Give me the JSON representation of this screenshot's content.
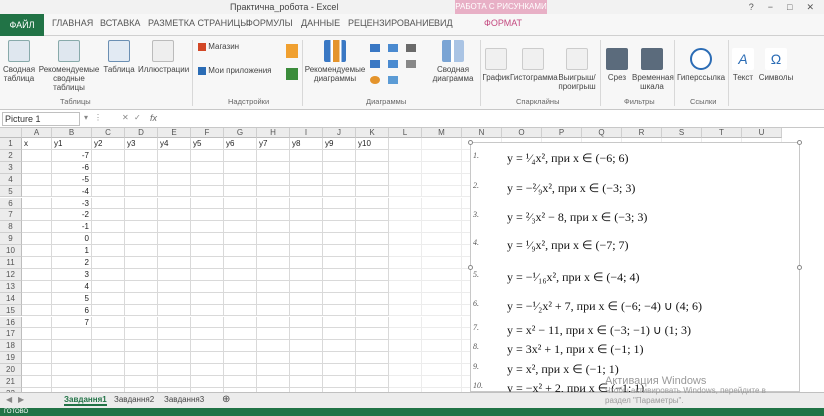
{
  "window": {
    "title": "Практична_робота - Excel",
    "context_tab": "РАБОТА С РИСУНКАМИ",
    "controls": [
      "?",
      "−",
      "□",
      "✕"
    ]
  },
  "tabs": [
    "ФАЙЛ",
    "ГЛАВНАЯ",
    "ВСТАВКА",
    "РАЗМЕТКА СТРАНИЦЫ",
    "ФОРМУЛЫ",
    "ДАННЫЕ",
    "РЕЦЕНЗИРОВАНИЕ",
    "ВИД",
    "ФОРМАТ"
  ],
  "ribbon": {
    "buttons": [
      "Сводная таблица",
      "Рекомендуемые сводные таблицы",
      "Таблица",
      "Иллюстрации",
      "Магазин",
      "Мои приложения",
      "Рекомендуемые диаграммы",
      "Сводная диаграмма",
      "График",
      "Гистограмма",
      "Выигрыш/ проигрыш",
      "Срез",
      "Временная шкала",
      "Гиперссылка",
      "Текст",
      "Символы"
    ],
    "groups": [
      "Таблицы",
      "Надстройки",
      "Диаграммы",
      "Спарклайны",
      "Фильтры",
      "Ссылки"
    ]
  },
  "formula_bar": {
    "name_box": "Picture 1",
    "fx_label": "fx",
    "icons": [
      "▾",
      "⋮",
      "✕",
      "✓"
    ]
  },
  "columns": [
    "A",
    "B",
    "C",
    "D",
    "E",
    "F",
    "G",
    "H",
    "I",
    "J",
    "K",
    "L",
    "M",
    "N",
    "O",
    "P",
    "Q",
    "R",
    "S",
    "T",
    "U"
  ],
  "rows": [
    "1",
    "2",
    "3",
    "4",
    "5",
    "6",
    "7",
    "8",
    "9",
    "10",
    "11",
    "12",
    "13",
    "14",
    "15",
    "16",
    "17",
    "18",
    "19",
    "20",
    "21",
    "22"
  ],
  "sheet": {
    "header_row": [
      "x",
      "y1",
      "y2",
      "y3",
      "y4",
      "y5",
      "y6",
      "y7",
      "y8",
      "y9",
      "y10"
    ],
    "x_values": [
      "-7",
      "-6",
      "-5",
      "-4",
      "-3",
      "-2",
      "-1",
      "0",
      "1",
      "2",
      "3",
      "4",
      "5",
      "6",
      "7"
    ]
  },
  "equations": [
    {
      "n": "1.",
      "text": "y = ¹⁄₄x², при x ∈ (−6; 6)"
    },
    {
      "n": "2.",
      "text": "y = −²⁄₉x², при x ∈ (−3; 3)"
    },
    {
      "n": "3.",
      "text": "y = ²⁄₃x² − 8, при x ∈ (−3; 3)"
    },
    {
      "n": "4.",
      "text": "y = ¹⁄₉x², при x ∈ (−7; 7)"
    },
    {
      "n": "5.",
      "text": "y = −¹⁄₁₆x², при x ∈ (−4; 4)"
    },
    {
      "n": "6.",
      "text": "y = −¹⁄₂x² + 7, при x ∈ (−6; −4) ∪ (4; 6)"
    },
    {
      "n": "7.",
      "text": "y = x² − 11, при x ∈ (−3; −1) ∪ (1; 3)"
    },
    {
      "n": "8.",
      "text": "y = 3x² + 1, при x ∈ (−1; 1)"
    },
    {
      "n": "9.",
      "text": "y = x², при x ∈ (−1; 1)"
    },
    {
      "n": "10.",
      "text": "y = −x² + 2, при x ∈ (−1; 1)"
    }
  ],
  "sheets": [
    "Завдання1",
    "Завдання2",
    "Завдання3"
  ],
  "add_sheet": "⊕",
  "status": "ГОТОВО",
  "watermark": {
    "line1": "Активация Windows",
    "line2": "Чтобы активировать Windows, перейдите в",
    "line3": "раздел \"Параметры\"."
  },
  "colors": {
    "accent": "#217346",
    "format_tab": "#c44a80"
  }
}
